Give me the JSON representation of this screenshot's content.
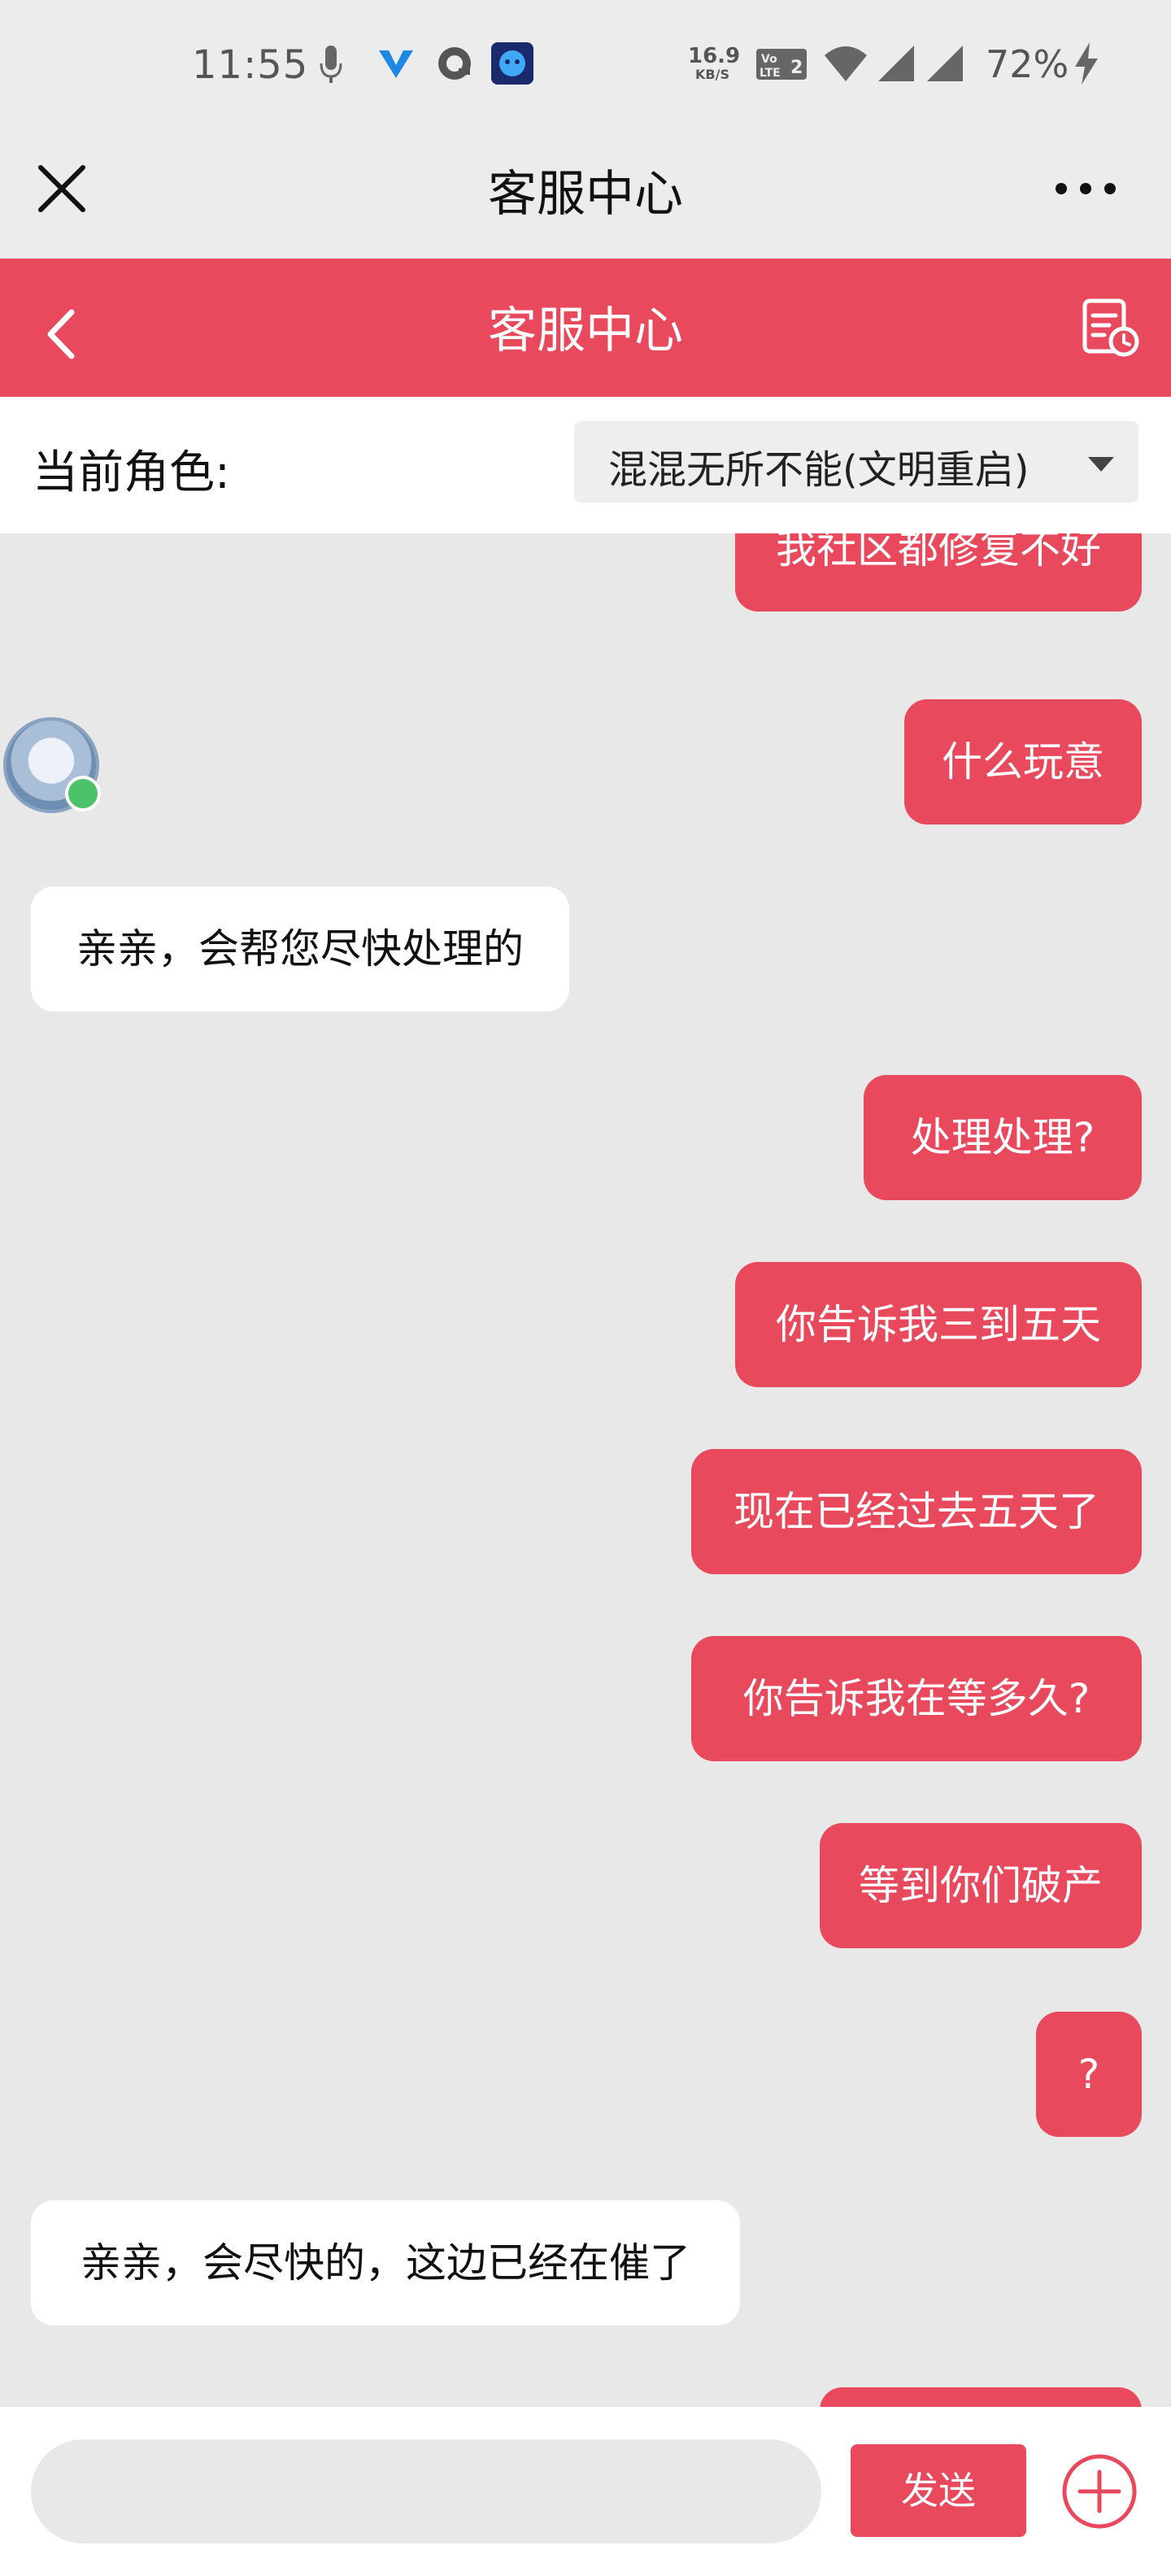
{
  "status_bar": {
    "time": "11:55",
    "net_speed_value": "16.9",
    "net_speed_unit": "KB/S",
    "volte": "VoLTE 2",
    "battery": "72%",
    "icons": [
      "microphone-icon",
      "v-app-icon",
      "q-app-icon",
      "robot-app-icon",
      "volte-icon",
      "wifi-icon",
      "signal-icon",
      "signal-icon",
      "charging-icon"
    ]
  },
  "title_bar": {
    "title": "客服中心",
    "icons": [
      "close-icon",
      "more-icon"
    ]
  },
  "header": {
    "title": "客服中心",
    "icons": [
      "back-icon",
      "record-history-icon"
    ],
    "color": "#e8495c"
  },
  "role": {
    "label": "当前角色:",
    "value": "混混无所不能(文明重启)"
  },
  "messages": [
    {
      "side": "out",
      "text": "我社区都修复不好"
    },
    {
      "side": "out",
      "text": "什么玩意"
    },
    {
      "side": "in",
      "text": "亲亲，会帮您尽快处理的"
    },
    {
      "side": "out",
      "text": "处理处理?"
    },
    {
      "side": "out",
      "text": "你告诉我三到五天"
    },
    {
      "side": "out",
      "text": "现在已经过去五天了"
    },
    {
      "side": "out",
      "text": "你告诉我在等多久?"
    },
    {
      "side": "out",
      "text": "等到你们破产"
    },
    {
      "side": "out",
      "text": "?"
    },
    {
      "side": "in",
      "text": "亲亲，会尽快的，这边已经在催了"
    },
    {
      "side": "out",
      "text": ""
    }
  ],
  "input": {
    "placeholder": "",
    "send_label": "发送"
  },
  "colors": {
    "accent": "#e8495c",
    "background": "#e8e8e8"
  }
}
